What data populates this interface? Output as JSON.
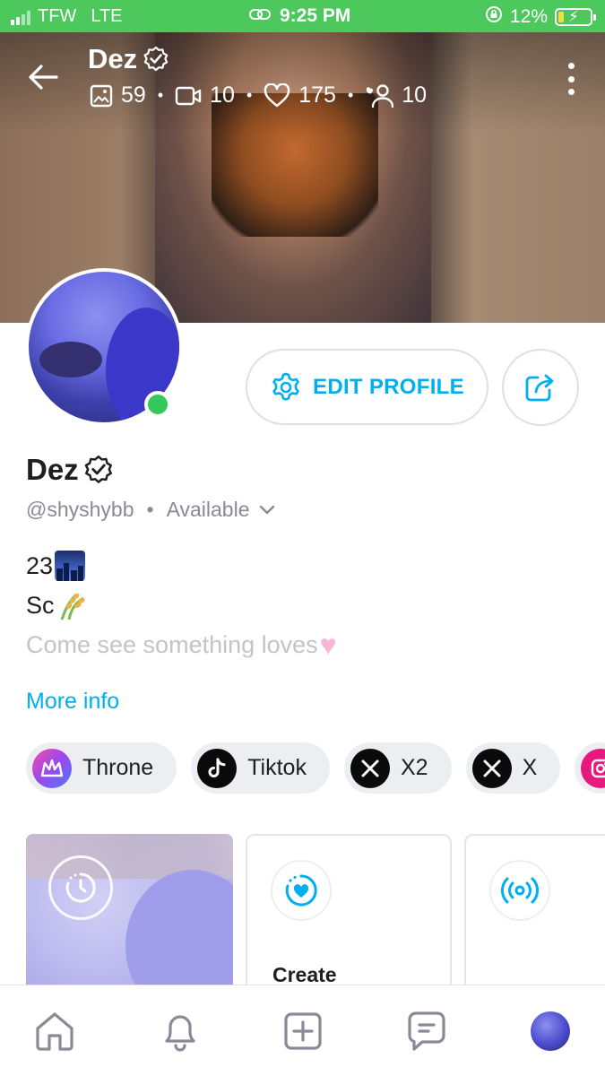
{
  "status_bar": {
    "carrier": "TFW",
    "network": "LTE",
    "time": "9:25 PM",
    "battery": "12%",
    "battery_level": 0.12
  },
  "header": {
    "name": "Dez",
    "verified": true,
    "stats": {
      "photos": "59",
      "videos": "10",
      "likes": "175",
      "subscribers": "10"
    }
  },
  "profile": {
    "edit_label": "EDIT PROFILE",
    "name": "Dez",
    "handle": "@shyshybb",
    "status": "Available",
    "online": true,
    "bio": {
      "line1": "23",
      "line2": "Sc",
      "line3": "Come see something loves"
    },
    "more_info": "More info"
  },
  "links": [
    {
      "label": "Throne",
      "icon": "throne-icon"
    },
    {
      "label": "Tiktok",
      "icon": "tiktok-icon"
    },
    {
      "label": "X2",
      "icon": "x-icon"
    },
    {
      "label": "X",
      "icon": "x-icon"
    },
    {
      "label": "",
      "icon": "instagram-icon"
    }
  ],
  "cards": {
    "create_label": "Create"
  },
  "colors": {
    "accent": "#00aff0",
    "status_bar": "#4cc85c",
    "online": "#34c759",
    "text_muted": "#8a8a96"
  },
  "nav": [
    "home-icon",
    "bell-icon",
    "plus-square-icon",
    "message-icon",
    "profile-avatar"
  ]
}
